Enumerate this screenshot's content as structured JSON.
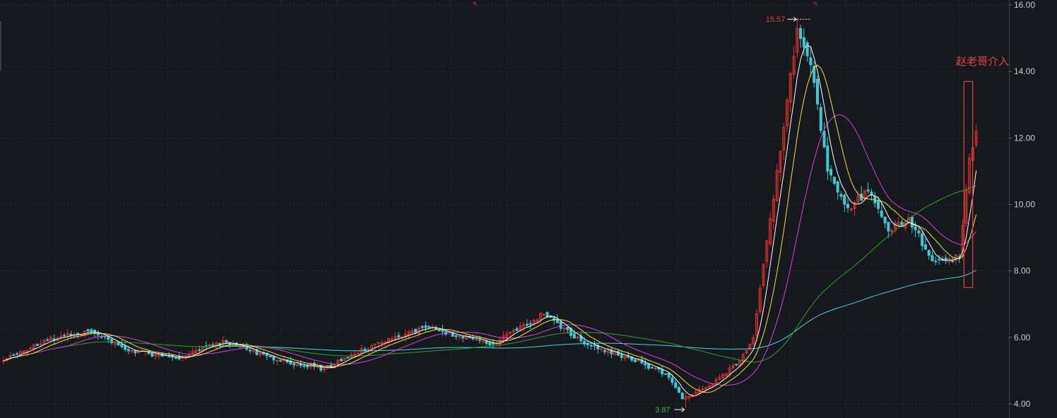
{
  "chart_data": {
    "type": "candlestick",
    "ylim": [
      3.8,
      16.1
    ],
    "y_ticks": [
      "4.00",
      "6.00",
      "8.00",
      "10.00",
      "12.00",
      "14.00",
      "16.00"
    ],
    "grid": true,
    "colors": {
      "background": "#15181d",
      "grid": "#2a2f37",
      "up": "#e0322b",
      "down": "#3ec8d8",
      "ma5": "#ffffff",
      "ma10": "#f2e829",
      "ma20": "#e23de3",
      "ma60": "#2aa728",
      "ma120": "#4cd3ea",
      "annotation": "#e8433b",
      "low_label": "#33c140"
    },
    "high_marker": {
      "value": 15.57,
      "label": "15.57"
    },
    "low_marker": {
      "value": 3.87,
      "label": "3.87"
    },
    "annotation": {
      "text": "赵老哥介入",
      "box_range": [
        7.5,
        13.7
      ]
    },
    "segments": [
      {
        "to_index": 0,
        "price": 5.3
      },
      {
        "to_index": 12,
        "price": 5.9
      },
      {
        "to_index": 25,
        "price": 6.2
      },
      {
        "to_index": 38,
        "price": 5.6
      },
      {
        "to_index": 52,
        "price": 5.35
      },
      {
        "to_index": 65,
        "price": 5.9
      },
      {
        "to_index": 82,
        "price": 5.3
      },
      {
        "to_index": 95,
        "price": 5.05
      },
      {
        "to_index": 110,
        "price": 5.8
      },
      {
        "to_index": 125,
        "price": 6.3
      },
      {
        "to_index": 135,
        "price": 6.05
      },
      {
        "to_index": 145,
        "price": 5.8
      },
      {
        "to_index": 160,
        "price": 6.7
      },
      {
        "to_index": 172,
        "price": 5.8
      },
      {
        "to_index": 185,
        "price": 5.4
      },
      {
        "to_index": 196,
        "price": 4.9
      },
      {
        "to_index": 201,
        "price": 4.15
      },
      {
        "to_index": 210,
        "price": 4.6
      },
      {
        "to_index": 218,
        "price": 5.3
      },
      {
        "to_index": 222,
        "price": 6.0
      },
      {
        "to_index": 226,
        "price": 8.9
      },
      {
        "to_index": 230,
        "price": 11.6
      },
      {
        "to_index": 235,
        "price": 15.3
      },
      {
        "to_index": 239,
        "price": 14.2
      },
      {
        "to_index": 244,
        "price": 11.0
      },
      {
        "to_index": 250,
        "price": 9.9
      },
      {
        "to_index": 256,
        "price": 10.4
      },
      {
        "to_index": 262,
        "price": 9.2
      },
      {
        "to_index": 268,
        "price": 9.6
      },
      {
        "to_index": 275,
        "price": 8.3
      },
      {
        "to_index": 283,
        "price": 8.4
      },
      {
        "to_index": 286,
        "price": 11.4
      },
      {
        "to_index": 288,
        "price": 12.2
      }
    ]
  }
}
